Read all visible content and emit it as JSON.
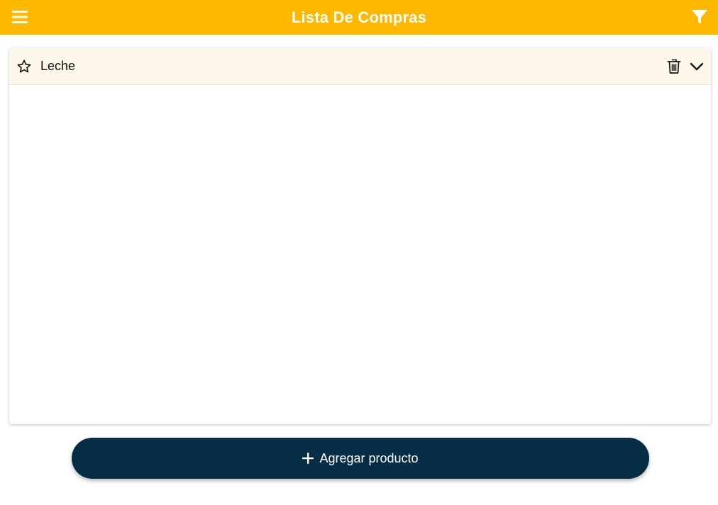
{
  "header": {
    "title": "Lista De Compras",
    "menu_icon": "hamburger-menu-icon",
    "filter_icon": "filter-funnel-icon"
  },
  "list": {
    "items": [
      {
        "name": "Leche",
        "favorite": false,
        "icons": [
          "star-outline-icon",
          "trash-icon",
          "chevron-down-icon"
        ]
      }
    ]
  },
  "actions": {
    "add_product_label": "Agregar producto",
    "add_icon": "plus-icon"
  },
  "colors": {
    "header_bg": "#FFB800",
    "item_row_bg": "#FEF8EA",
    "add_button_bg": "#052E46",
    "text_on_accent": "#FFFFFF"
  }
}
